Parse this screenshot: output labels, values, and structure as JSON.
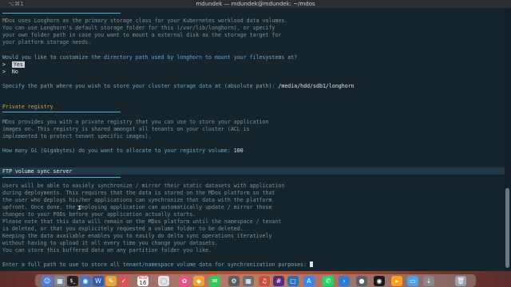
{
  "window": {
    "left_text": "⌥⌘1",
    "title": "mdundek — mdundek@mdundek: ~/mdos"
  },
  "lines": {
    "l1": "MDos uses Longhorn as the primary storage class for your Kubernetes workload data volumes.",
    "l2": "You can use Longhorn's default storage folder for this (/var/lib/longhorn), or specify",
    "l3": "your own folder path in case you want to mount a external disk as the storage target for",
    "l4": "your platform storage needs.",
    "q1": "Would you like to customize the directory path used by longhorn to mount your filesystems at?",
    "opt_yes": "Yes",
    "opt_no": "No",
    "path_prompt": "Specify the path where you wish to store your cluster storage data at (absolute path): ",
    "path_value": "/media/hdd/sdb1/longhorn",
    "reg_head": "Private registry",
    "reg1": "MDos provides you with a private registry that you can use to store your application",
    "reg2": "images on. This registry is shared amongst all tenants on your cluster (ACL is",
    "reg3": "implemented to protect tenant specific images).",
    "reg_prompt": "How many Gi (Gigabytes) do you want to allocate to your registry volume: ",
    "reg_value": "100",
    "ftp_head": "FTP volume sync server",
    "f1": "Users will be able to easiely synchronize / mirror their static datasets with application",
    "f2": "during deployments. This requires that the data is stored on the MDos platform so that",
    "f3": "the user who deploys his/her applications can synchronize that data with the platform",
    "f4": "upfront. Once done, the deploying application can automatically update / mirror those",
    "f5": "changes to your PODs before your application actually starts.",
    "f6": "Please note that this data will remain on the MDos platform until the namespace / tenant",
    "f7": "is deleted, or that you explicitely requested a volume folder to be deleted.",
    "f8": "Keeping the data available enables you to easily do delta sync operations iteratively",
    "f9": "without having to upload it all every time you change your datasets.",
    "f10": "You can store this buffered data on any partition folder you like.",
    "final_prompt": "Enter a full path to use to store all tenant/namespace volume data for synchronization purposes: "
  },
  "dock": {
    "calendar_month": "NOV",
    "calendar_day": "16",
    "terminal_glyph": "$_",
    "word_glyph": "W"
  }
}
